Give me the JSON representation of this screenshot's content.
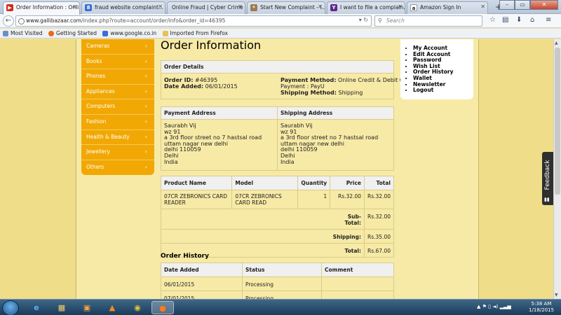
{
  "browser": {
    "tabs": [
      {
        "label": "Order Information : Onli...",
        "icon": "youtube-like-icon",
        "active": true
      },
      {
        "label": "fraud website complaint...",
        "icon": "google-icon"
      },
      {
        "label": "Online Fraud | Cyber Crime I...",
        "icon": "blank-page-icon"
      },
      {
        "label": "Start New Complaint - i...",
        "icon": "complaint-site-icon"
      },
      {
        "label": "I want to file a complain...",
        "icon": "yahoo-icon"
      },
      {
        "label": "Amazon Sign In",
        "icon": "amazon-icon"
      }
    ],
    "url_host": "www.gallibazaar.com",
    "url_path": "/index.php?route=account/order/info&order_id=46395",
    "search_placeholder": "Search",
    "bookmarks": [
      {
        "label": "Most Visited"
      },
      {
        "label": "Getting Started"
      },
      {
        "label": "www.google.co.in"
      },
      {
        "label": "Imported From Firefox"
      }
    ]
  },
  "sidebar": {
    "categories": [
      {
        "label": "Cameras"
      },
      {
        "label": "Books"
      },
      {
        "label": "Phones"
      },
      {
        "label": "Appliances"
      },
      {
        "label": "Computers"
      },
      {
        "label": "Fashion"
      },
      {
        "label": "Health & Beauty"
      },
      {
        "label": "Jewellery"
      },
      {
        "label": "Others"
      }
    ]
  },
  "page": {
    "title": "Order Information",
    "order_details": {
      "heading": "Order Details",
      "order_id_label": "Order ID:",
      "order_id": "#46395",
      "date_added_label": "Date Added:",
      "date_added": "06/01/2015",
      "payment_method_label": "Payment Method:",
      "payment_method": "Online Credit & Debit Card",
      "payment_label": "Payment :",
      "payment": "PayU",
      "shipping_method_label": "Shipping Method:",
      "shipping_method": "Shipping"
    },
    "addresses": {
      "payment_heading": "Payment Address",
      "shipping_heading": "Shipping Address",
      "payment_lines": [
        "Saurabh Vij",
        "wz 91",
        "a 3rd floor street no 7 hastsal road",
        "uttam nagar new delhi",
        "delhi 110059",
        "Delhi",
        "India"
      ],
      "shipping_lines": [
        "Saurabh Vij",
        "wz 91",
        "a 3rd floor street no 7 hastsal road",
        "uttam nagar new delhi",
        "delhi 110059",
        "Delhi",
        "India"
      ]
    },
    "products": {
      "headers": {
        "name": "Product Name",
        "model": "Model",
        "quantity": "Quantity",
        "price": "Price",
        "total": "Total"
      },
      "rows": [
        {
          "name": "07CR ZEBRONICS CARD READER",
          "model": "07CR ZEBRONICS CARD READ",
          "quantity": "1",
          "price": "Rs.32.00",
          "total": "Rs.32.00"
        }
      ],
      "subtotal_label": "Sub-Total:",
      "subtotal": "Rs.32.00",
      "shipping_label": "Shipping:",
      "shipping": "Rs.35.00",
      "total_label": "Total:",
      "total": "Rs.67.00"
    },
    "history": {
      "title": "Order History",
      "headers": {
        "date": "Date Added",
        "status": "Status",
        "comment": "Comment"
      },
      "rows": [
        {
          "date": "06/01/2015",
          "status": "Processing",
          "comment": ""
        },
        {
          "date": "07/01/2015",
          "status": "Processing",
          "comment": ""
        }
      ]
    }
  },
  "account_menu": {
    "items": [
      {
        "label": "My Account"
      },
      {
        "label": "Edit Account"
      },
      {
        "label": "Password"
      },
      {
        "label": "Wish List"
      },
      {
        "label": "Order History"
      },
      {
        "label": "Wallet"
      },
      {
        "label": "Newsletter"
      },
      {
        "label": "Logout"
      }
    ]
  },
  "feedback_tab": {
    "label": "Feedback"
  },
  "taskbar": {
    "time": "5:38 AM",
    "date": "1/18/2015",
    "apps": [
      "start-orb-icon",
      "internet-explorer-icon",
      "file-explorer-icon",
      "media-player-icon",
      "vlc-icon",
      "chrome-icon",
      "firefox-icon"
    ]
  },
  "colors": {
    "sidebar": "#f1a804",
    "page_background": "#f7eaa6",
    "outer_background": "#f0dd8a"
  }
}
